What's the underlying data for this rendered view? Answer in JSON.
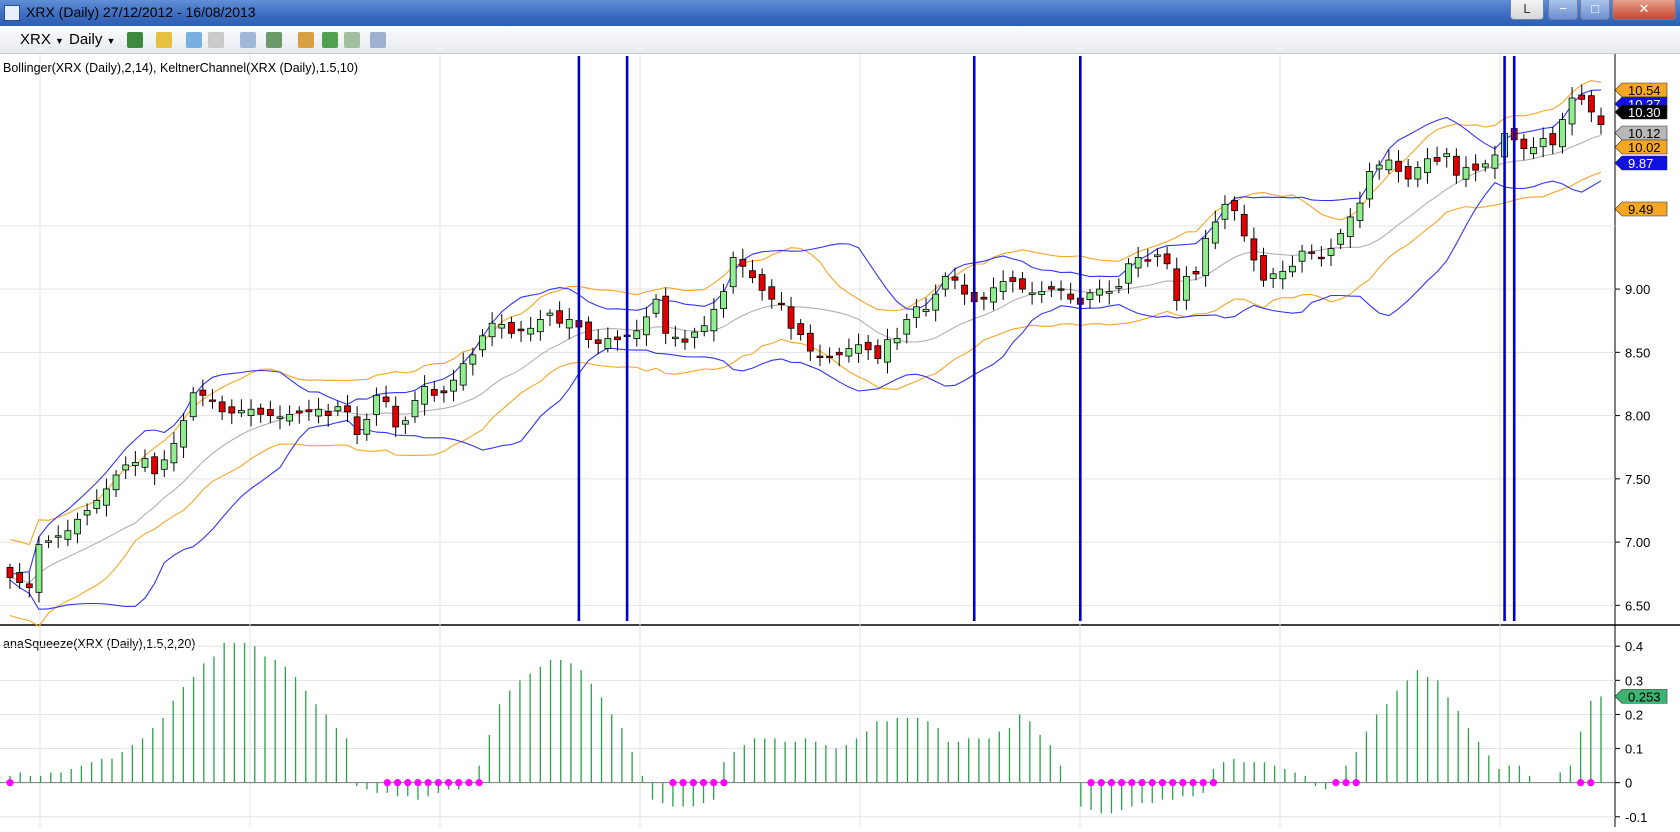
{
  "window": {
    "title": "XRX (Daily)  27/12/2012 - 16/08/2013",
    "l_button": "L",
    "minimize_glyph": "−",
    "maximize_glyph": "□",
    "close_glyph": "✕"
  },
  "toolbar": {
    "symbol": "XRX",
    "interval": "Daily",
    "icons": [
      "bar-chart-icon",
      "pencil-icon",
      "magic-wand-icon",
      "cursor-icon",
      "zoom-icon",
      "candles-icon",
      "chart-style-icon",
      "indicator-icon",
      "export-icon",
      "properties-icon"
    ]
  },
  "chart_data": [
    {
      "type": "candlestick",
      "title": "Bollinger(XRX  (Daily),2,14),  KeltnerChannel(XRX  (Daily),1.5,10)",
      "yticks": [
        "6.50",
        "7.00",
        "7.50",
        "8.00",
        "8.50",
        "9.00"
      ],
      "ylim": [
        6.4,
        10.7
      ],
      "price_labels": [
        {
          "value": "10.54",
          "color": "#f5a623"
        },
        {
          "value": "10.37",
          "color": "#1010e0"
        },
        {
          "value": "10.30",
          "color": "#000000"
        },
        {
          "value": "10.12",
          "color": "#b8b8b8"
        },
        {
          "value": "10.02",
          "color": "#f5a623"
        },
        {
          "value": "9.87",
          "color": "#1010e0"
        },
        {
          "value": "9.49",
          "color": "#f5a623"
        }
      ],
      "squeeze_lines_bar_index": [
        59,
        64,
        100,
        111,
        155,
        156
      ],
      "colors": {
        "up": "#90ee90",
        "down": "#e00000",
        "bollinger": "#3535f0",
        "keltner": "#f5a623",
        "mid": "#b0b0b0",
        "squeeze": "#0000cc"
      },
      "close": [
        6.72,
        6.68,
        6.64,
        6.98,
        7.01,
        7.05,
        7.09,
        7.18,
        7.25,
        7.33,
        7.42,
        7.53,
        7.61,
        7.63,
        7.66,
        7.54,
        7.65,
        7.78,
        7.96,
        8.18,
        8.16,
        8.12,
        8.03,
        8.02,
        8.04,
        8.05,
        8.01,
        8.0,
        7.99,
        8.01,
        8.02,
        8.03,
        8.05,
        8.0,
        8.07,
        8.03,
        7.85,
        7.97,
        8.16,
        8.11,
        7.91,
        7.96,
        8.12,
        8.23,
        8.16,
        8.18,
        8.28,
        8.41,
        8.48,
        8.63,
        8.73,
        8.72,
        8.65,
        8.67,
        8.69,
        8.76,
        8.81,
        8.73,
        8.76,
        8.7,
        8.6,
        8.57,
        8.61,
        8.6,
        8.63,
        8.67,
        8.78,
        8.92,
        8.65,
        8.62,
        8.58,
        8.66,
        8.71,
        8.84,
        8.98,
        9.25,
        9.18,
        9.09,
        8.99,
        8.92,
        8.88,
        8.69,
        8.64,
        8.51,
        8.47,
        8.46,
        8.48,
        8.53,
        8.56,
        8.52,
        8.45,
        8.6,
        8.61,
        8.76,
        8.86,
        8.84,
        8.96,
        9.1,
        9.07,
        8.96,
        8.9,
        8.92,
        9.01,
        9.06,
        9.06,
        9.0,
        8.97,
        8.98,
        9.0,
        9.0,
        8.92,
        8.88,
        8.97,
        9.0,
        8.98,
        9.02,
        9.2,
        9.25,
        9.23,
        9.27,
        9.2,
        8.91,
        9.1,
        9.12,
        9.4,
        9.53,
        9.67,
        9.62,
        9.42,
        9.23,
        9.07,
        9.12,
        9.14,
        9.18,
        9.3,
        9.29,
        9.25,
        9.32,
        9.44,
        9.57,
        9.68,
        9.93,
        9.98,
        10.02,
        9.93,
        9.87,
        9.96,
        10.03,
        10.01,
        10.07,
        9.9,
        9.96,
        9.94,
        9.99,
        10.06,
        10.23,
        10.18,
        10.11,
        10.12,
        10.19,
        10.14,
        10.34,
        10.51,
        10.5,
        10.4,
        10.3
      ],
      "ohlc_note": "open/high/low derived by script from close for drawing",
      "subchart": {
        "type": "bar",
        "title": "anaSqueeze(XRX  (Daily),1.5,2,20)",
        "yticks": [
          "-0.1",
          "0",
          "0.1",
          "0.2",
          "0.3",
          "0.4"
        ],
        "ylim": [
          -0.13,
          0.43
        ],
        "last_value_label": "0.253",
        "bar_color": "#2aa14a",
        "dot_color": "#ff00ff",
        "values": [
          0.02,
          0.03,
          0.02,
          0.02,
          0.03,
          0.03,
          0.04,
          0.05,
          0.06,
          0.07,
          0.07,
          0.09,
          0.11,
          0.13,
          0.16,
          0.19,
          0.24,
          0.28,
          0.31,
          0.35,
          0.37,
          0.41,
          0.41,
          0.41,
          0.4,
          0.37,
          0.36,
          0.34,
          0.31,
          0.27,
          0.23,
          0.2,
          0.16,
          0.13,
          -0.01,
          -0.02,
          -0.03,
          -0.03,
          -0.04,
          -0.04,
          -0.05,
          -0.04,
          -0.03,
          -0.02,
          -0.02,
          0.01,
          0.05,
          0.14,
          0.23,
          0.27,
          0.3,
          0.32,
          0.34,
          0.36,
          0.36,
          0.35,
          0.33,
          0.29,
          0.25,
          0.2,
          0.16,
          0.09,
          0.02,
          -0.05,
          -0.06,
          -0.07,
          -0.07,
          -0.07,
          -0.06,
          -0.05,
          0.06,
          0.09,
          0.11,
          0.13,
          0.13,
          0.13,
          0.12,
          0.12,
          0.13,
          0.12,
          0.11,
          0.1,
          0.11,
          0.13,
          0.15,
          0.18,
          0.18,
          0.19,
          0.19,
          0.19,
          0.18,
          0.16,
          0.12,
          0.12,
          0.13,
          0.13,
          0.13,
          0.15,
          0.16,
          0.2,
          0.18,
          0.14,
          0.11,
          0.05,
          0.0,
          -0.07,
          -0.08,
          -0.09,
          -0.09,
          -0.08,
          -0.07,
          -0.06,
          -0.06,
          -0.05,
          -0.05,
          -0.04,
          -0.04,
          -0.03,
          0.04,
          0.06,
          0.07,
          0.06,
          0.06,
          0.06,
          0.05,
          0.04,
          0.03,
          0.02,
          -0.01,
          -0.02,
          0.01,
          0.05,
          0.09,
          0.15,
          0.2,
          0.23,
          0.27,
          0.3,
          0.33,
          0.31,
          0.3,
          0.25,
          0.21,
          0.16,
          0.12,
          0.08,
          0.04,
          0.05,
          0.05,
          0.02,
          0.0,
          0.0,
          0.03,
          0.05,
          0.15,
          0.24,
          0.253
        ],
        "squeeze_on_idx": [
          0,
          37,
          38,
          39,
          40,
          41,
          42,
          43,
          44,
          45,
          46,
          65,
          66,
          67,
          68,
          69,
          70,
          106,
          107,
          108,
          109,
          110,
          111,
          112,
          113,
          114,
          115,
          116,
          117,
          118,
          130,
          131,
          132,
          154,
          155
        ]
      }
    }
  ]
}
